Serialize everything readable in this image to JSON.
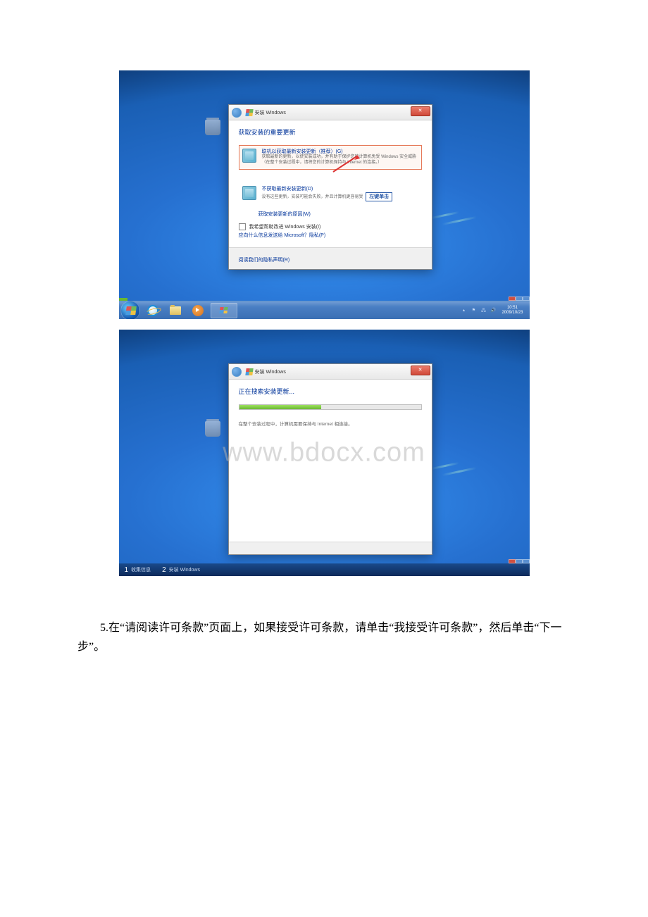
{
  "screenshot1": {
    "dialog": {
      "title": "安装 Windows",
      "heading": "获取安装的重要更新",
      "option1": {
        "title": "联机以获取最新安装更新（推荐）(G)",
        "desc": "获取最新的更新，以使安装成功，并有助于保护您的计算机免受 Windows 安全威胁（在整个安装过程中，请将您的计算机保持与 Internet 的连接。）"
      },
      "option2": {
        "title": "不获取最新安装更新(D)",
        "desc": "没有这些更新，安装可能会失败，并且计算机更容易受"
      },
      "annotation": "左键单击",
      "helpLink": "获取安装更新的原因(W)",
      "checkbox": "我希望帮助改进 Windows 安装(I)",
      "sendInfoLink": "应向什么信息发送给 Microsoft？隐私(P)",
      "footerLink": "阅读我们的隐私声明(R)"
    },
    "taskbar": {
      "trayVolume": "音量",
      "trayNetwork": "网络",
      "clock": {
        "time": "10:51",
        "date": "2009/10/23"
      }
    }
  },
  "screenshot2": {
    "dialog": {
      "title": "安装 Windows",
      "heading": "正在搜索安装更新...",
      "note": "在整个安装过程中，计算机需要保持与 Internet 相连接。"
    },
    "taskbar": {
      "item1": {
        "num": "1",
        "label": "收集信息"
      },
      "item2": {
        "num": "2",
        "label": "安装 Windows"
      }
    },
    "watermark": "www.bdocx.com"
  },
  "paragraph": "5.在“请阅读许可条款”页面上，如果接受许可条款，请单击“我接受许可条款”，然后单击“下一步”。"
}
